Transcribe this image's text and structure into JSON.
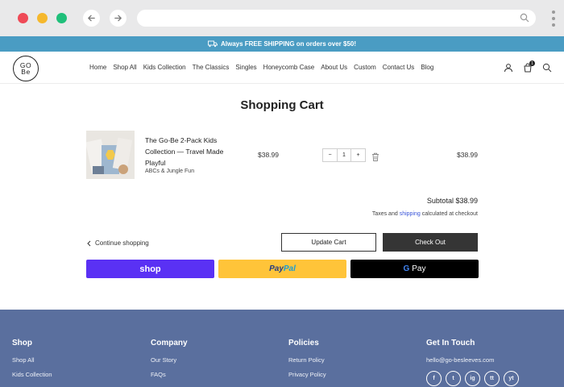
{
  "announcement": {
    "text": "Always FREE SHIPPING on orders over $50!"
  },
  "brand": {
    "logo_line1": "GO",
    "logo_line2": "Be"
  },
  "nav": {
    "items": [
      "Home",
      "Shop All",
      "Kids Collection",
      "The Classics",
      "Singles",
      "Honeycomb Case",
      "About Us",
      "Custom",
      "Contact Us",
      "Blog"
    ]
  },
  "header": {
    "cart_count": "1"
  },
  "cart": {
    "title": "Shopping Cart",
    "item": {
      "name": "The Go-Be 2-Pack Kids Collection — Travel Made Playful",
      "variant": "ABCs & Jungle Fun",
      "price": "$38.99",
      "quantity": "1",
      "quantity_minus": "−",
      "quantity_plus": "+",
      "total": "$38.99"
    },
    "subtotal_label": "Subtotal",
    "subtotal_value": "$38.99",
    "taxes_prefix": "Taxes and",
    "taxes_link": "shipping",
    "taxes_suffix": "calculated at checkout",
    "continue_label": "Continue shopping",
    "update_label": "Update Cart",
    "checkout_label": "Check Out"
  },
  "payments": {
    "shop_label": "shop",
    "paypal_label_1": "Pay",
    "paypal_label_2": "Pal",
    "gpay_g": "G",
    "gpay_label": "Pay"
  },
  "colors": {
    "shop": "#5a31f4",
    "paypal": "#ffc439",
    "footer": "#5a6f9e",
    "announce": "#4a9cc3"
  },
  "footer": {
    "shop": {
      "heading": "Shop",
      "links": [
        "Shop All",
        "Kids Collection"
      ]
    },
    "company": {
      "heading": "Company",
      "links": [
        "Our Story",
        "FAQs"
      ]
    },
    "policies": {
      "heading": "Policies",
      "links": [
        "Return Policy",
        "Privacy Policy"
      ]
    },
    "contact": {
      "heading": "Get In Touch",
      "email": "hello@go-besleeves.com"
    },
    "social": [
      "f",
      "t",
      "ig",
      "tt",
      "yt"
    ]
  }
}
